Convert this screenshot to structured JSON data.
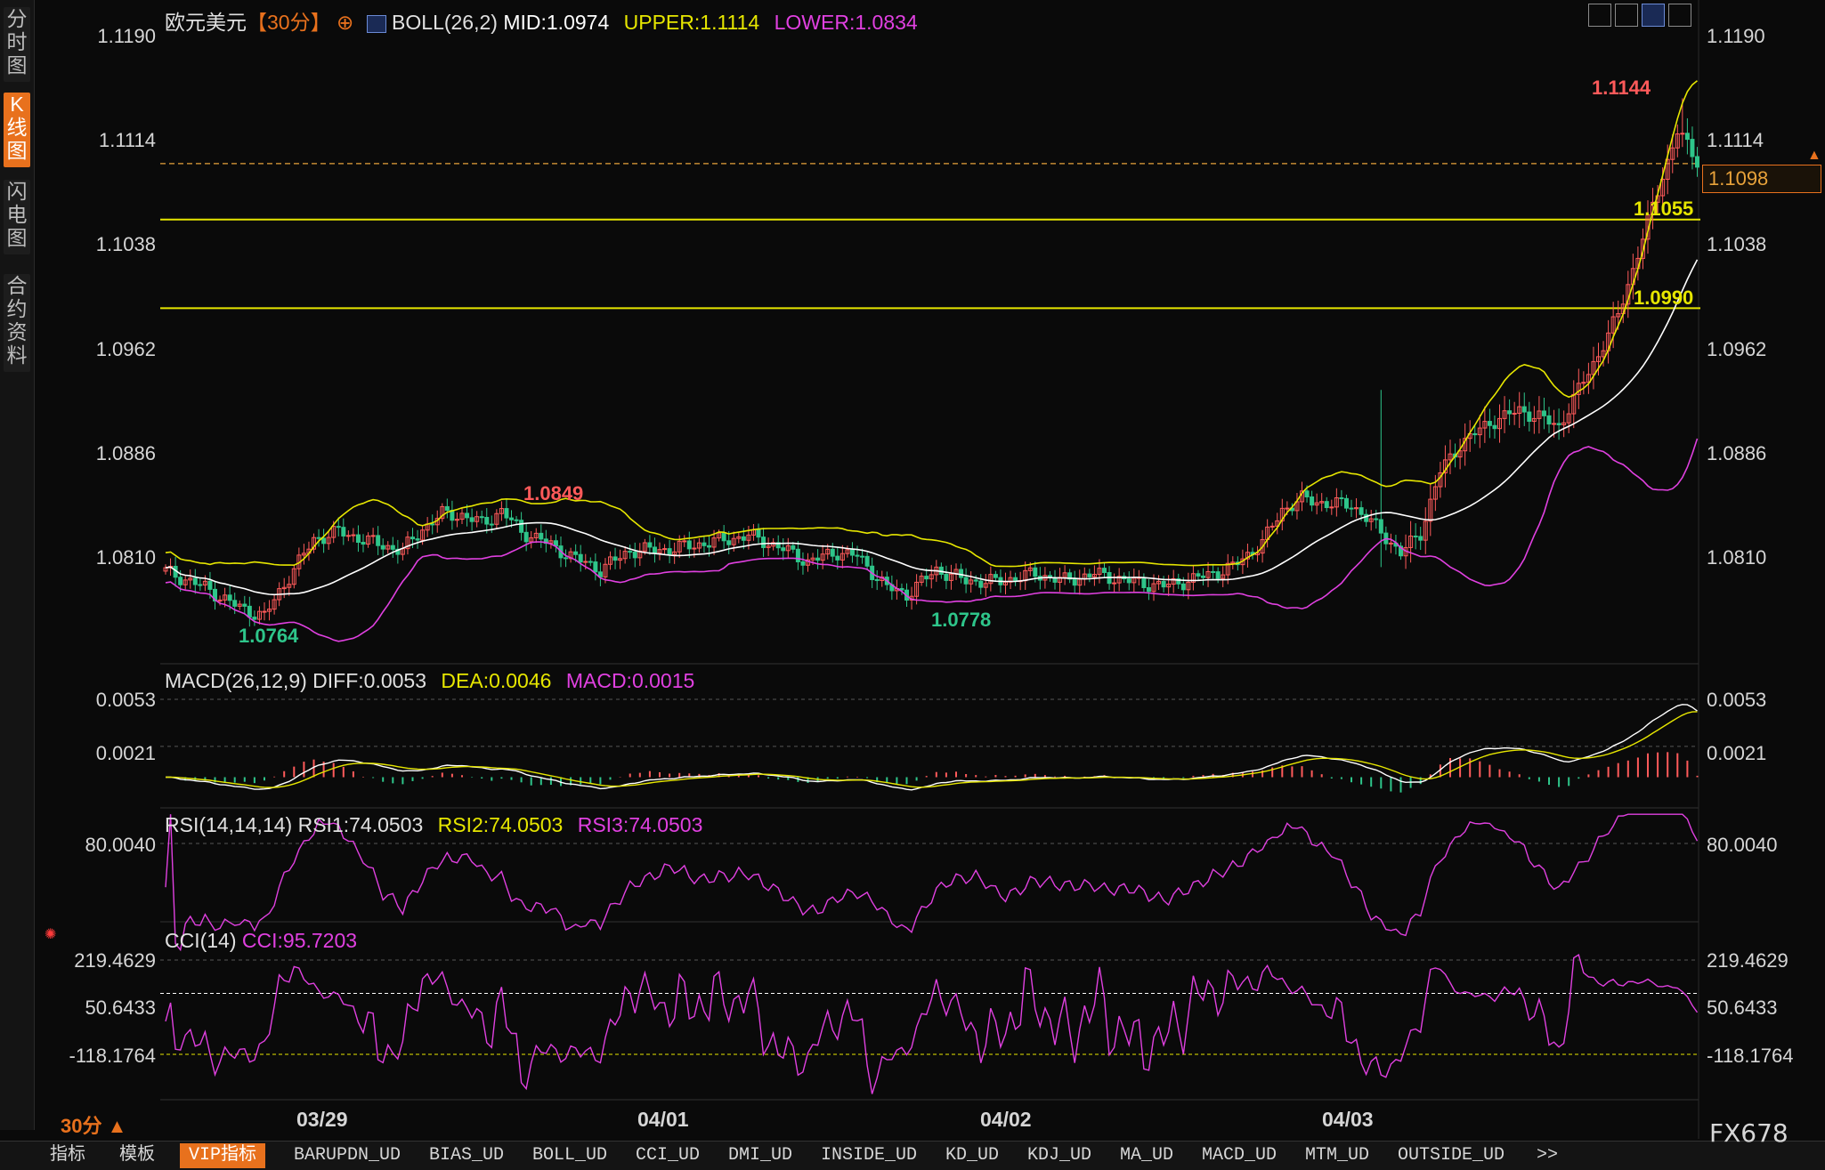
{
  "sidebar": {
    "tabs": [
      "分\n时\n图",
      "K\n线\n图",
      "闪\n电\n图",
      "合\n约\n资\n料"
    ],
    "active": 1
  },
  "header": {
    "symbol": "欧元美元",
    "period": "【30分】",
    "indicator": "BOLL(26,2)",
    "mid": "MID:1.0974",
    "upper": "UPPER:1.1114",
    "lower": "LOWER:1.0834"
  },
  "price_axis": {
    "ticks": [
      "1.1190",
      "1.1114",
      "1.1038",
      "1.0962",
      "1.0886",
      "1.0810"
    ]
  },
  "current_price": "1.1098",
  "levels": [
    "1.1055",
    "1.0990"
  ],
  "annotations": {
    "high": "1.1144",
    "peak": "1.0849",
    "low1": "1.0764",
    "low2": "1.0778"
  },
  "macd": {
    "title": "MACD(26,12,9)",
    "diff": "DIFF:0.0053",
    "dea": "DEA:0.0046",
    "macd": "MACD:0.0015",
    "ticks": [
      "0.0053",
      "0.0021"
    ]
  },
  "rsi": {
    "title": "RSI(14,14,14)",
    "rsi1": "RSI1:74.0503",
    "rsi2": "RSI2:74.0503",
    "rsi3": "RSI3:74.0503",
    "ticks": [
      "80.0040"
    ]
  },
  "cci": {
    "title": "CCI(14)",
    "value": "CCI:95.7203",
    "ticks": [
      "219.4629",
      "50.6433",
      "-118.1764"
    ]
  },
  "dates": [
    "03/29",
    "04/01",
    "04/02",
    "04/03"
  ],
  "period_selector": "30分 ▲",
  "bottom_tabs": [
    "指标",
    "模板",
    "VIP指标",
    "BARUPDN_UD",
    "BIAS_UD",
    "BOLL_UD",
    "CCI_UD",
    "DMI_UD",
    "INSIDE_UD",
    "KD_UD",
    "KDJ_UD",
    "MA_UD",
    "MACD_UD",
    "MTM_UD",
    "OUTSIDE_UD",
    ">>"
  ],
  "watermark": "FX678",
  "colors": {
    "up": "#ff5a5a",
    "down": "#2ec58a",
    "boll_upper": "#e6e600",
    "boll_lower": "#e040e0",
    "mid": "#ffffff",
    "accent": "#e8711d"
  },
  "chart_data": {
    "type": "candlestick",
    "title": "欧元美元 30分",
    "y_ticks": [
      1.119,
      1.1114,
      1.1038,
      1.0962,
      1.0886,
      1.081
    ],
    "ylim": [
      1.075,
      1.1195
    ],
    "x_labels": [
      "03/29",
      "04/01",
      "04/02",
      "04/03"
    ],
    "price_path": [
      [
        0,
        1.0797
      ],
      [
        8,
        1.0785
      ],
      [
        15,
        1.077
      ],
      [
        20,
        1.0764
      ],
      [
        25,
        1.0793
      ],
      [
        30,
        1.082
      ],
      [
        35,
        1.0826
      ],
      [
        42,
        1.0818
      ],
      [
        48,
        1.0812
      ],
      [
        52,
        1.0828
      ],
      [
        56,
        1.0839
      ],
      [
        60,
        1.0838
      ],
      [
        64,
        1.0832
      ],
      [
        68,
        1.0841
      ],
      [
        72,
        1.0826
      ],
      [
        76,
        1.082
      ],
      [
        82,
        1.0808
      ],
      [
        88,
        1.0798
      ],
      [
        94,
        1.0812
      ],
      [
        102,
        1.0813
      ],
      [
        110,
        1.0818
      ],
      [
        118,
        1.0823
      ],
      [
        124,
        1.0815
      ],
      [
        130,
        1.0804
      ],
      [
        136,
        1.0811
      ],
      [
        140,
        1.0808
      ],
      [
        146,
        1.0785
      ],
      [
        150,
        1.078
      ],
      [
        156,
        1.0798
      ],
      [
        162,
        1.079
      ],
      [
        168,
        1.0789
      ],
      [
        172,
        1.0792
      ],
      [
        176,
        1.0795
      ],
      [
        182,
        1.079
      ],
      [
        188,
        1.0795
      ],
      [
        196,
        1.0789
      ],
      [
        202,
        1.0786
      ],
      [
        208,
        1.0791
      ],
      [
        216,
        1.08
      ],
      [
        222,
        1.0818
      ],
      [
        226,
        1.0842
      ],
      [
        230,
        1.085
      ],
      [
        236,
        1.0846
      ],
      [
        240,
        1.0846
      ],
      [
        246,
        1.0826
      ],
      [
        250,
        1.081
      ],
      [
        254,
        1.0825
      ],
      [
        258,
        1.087
      ],
      [
        262,
        1.089
      ],
      [
        268,
        1.0906
      ],
      [
        274,
        1.0915
      ],
      [
        278,
        1.091
      ],
      [
        282,
        1.0903
      ],
      [
        286,
        1.093
      ],
      [
        290,
        1.0956
      ],
      [
        294,
        1.0985
      ],
      [
        298,
        1.103
      ],
      [
        302,
        1.1076
      ],
      [
        306,
        1.112
      ],
      [
        310,
        1.1098
      ]
    ],
    "notable": {
      "high": 1.1144,
      "peak": 1.0849,
      "low1": 1.0764,
      "low2": 1.0778
    },
    "horizontal_levels": [
      1.1055,
      1.099
    ],
    "boll": {
      "mid": 1.0974,
      "upper": 1.1114,
      "lower": 1.0834
    },
    "macd": {
      "diff": 0.0053,
      "dea": 0.0046,
      "macd": 0.0015
    },
    "rsi": {
      "rsi1": 74.0503,
      "rsi2": 74.0503,
      "rsi3": 74.0503
    },
    "cci": {
      "value": 95.7203,
      "levels": [
        219.4629,
        50.6433,
        -118.1764
      ]
    }
  }
}
